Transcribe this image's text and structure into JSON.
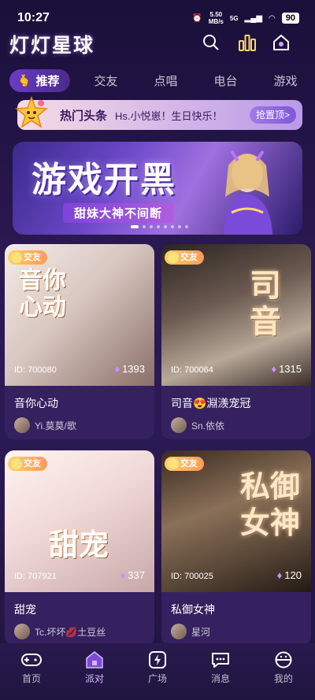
{
  "status": {
    "time": "10:27",
    "speed_top": "5.50",
    "speed_bottom": "MB/s",
    "network": "5G",
    "battery": "90"
  },
  "header": {
    "title": "灯灯星球"
  },
  "tabs": [
    {
      "label": "推荐",
      "active": true
    },
    {
      "label": "交友"
    },
    {
      "label": "点唱"
    },
    {
      "label": "电台"
    },
    {
      "label": "游戏"
    }
  ],
  "headline": {
    "tag": "热门头条",
    "text": "Hs.小悦崽！生日快乐！",
    "button": "抢置顶>"
  },
  "banner": {
    "title": "游戏开黑",
    "subtitle": "甜妹大神不间断",
    "slides": 8,
    "active_slide": 0
  },
  "rooms": [
    {
      "tag": "交友",
      "id": "ID: 700080",
      "count": "1393",
      "name": "音你心动",
      "host": "Yi.莫莫/歌",
      "overlay": "音你心动"
    },
    {
      "tag": "交友",
      "id": "ID: 700064",
      "count": "1315",
      "name": "司音😍淵㵪宠冠",
      "host": "Sn.依依",
      "overlay": "司音"
    },
    {
      "tag": "交友",
      "id": "ID: 707921",
      "count": "337",
      "name": "甜宠",
      "host": "Tc.坏坏💋土豆丝",
      "overlay": "甜宠"
    },
    {
      "tag": "交友",
      "id": "ID: 700025",
      "count": "120",
      "name": "私御女神",
      "host": "星河",
      "overlay": "私御女神"
    }
  ],
  "nav": [
    {
      "label": "首页",
      "icon": "gamepad-icon"
    },
    {
      "label": "派对",
      "icon": "party-house-icon",
      "active": true
    },
    {
      "label": "广场",
      "icon": "lightning-icon"
    },
    {
      "label": "消息",
      "icon": "chat-bubble-icon"
    },
    {
      "label": "我的",
      "icon": "profile-face-icon"
    }
  ],
  "colors": {
    "accent": "#b07cff",
    "tag": "#ff9a57",
    "background": "#2a1850"
  }
}
